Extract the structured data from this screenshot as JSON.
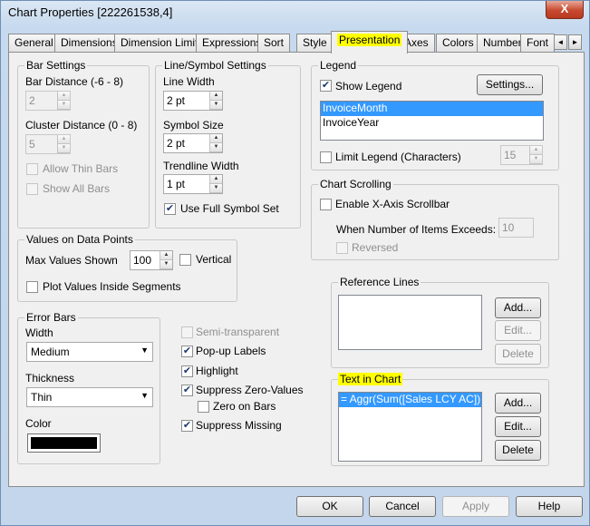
{
  "window": {
    "title": "Chart Properties [222261538,4]",
    "close_label": "X"
  },
  "tabs": [
    "General",
    "Dimensions",
    "Dimension Limits",
    "Expressions",
    "Sort",
    "Style",
    "Presentation",
    "Axes",
    "Colors",
    "Number",
    "Font"
  ],
  "active_tab": "Presentation",
  "tab_scroll": {
    "left": "◄",
    "right": "►"
  },
  "bar_settings": {
    "title": "Bar Settings",
    "bar_distance_label": "Bar Distance (-6 - 8)",
    "bar_distance_value": "2",
    "cluster_distance_label": "Cluster Distance (0 - 8)",
    "cluster_distance_value": "5",
    "allow_thin_bars": "Allow Thin Bars",
    "show_all_bars": "Show All Bars"
  },
  "line_symbol": {
    "title": "Line/Symbol Settings",
    "line_width_label": "Line Width",
    "line_width_value": "2 pt",
    "symbol_size_label": "Symbol Size",
    "symbol_size_value": "2 pt",
    "trendline_width_label": "Trendline Width",
    "trendline_width_value": "1 pt",
    "use_full_symbol_set": "Use Full Symbol Set"
  },
  "values_on_points": {
    "title": "Values on Data Points",
    "max_values_label": "Max Values Shown",
    "max_values_value": "100",
    "vertical": "Vertical",
    "plot_inside": "Plot Values Inside Segments"
  },
  "error_bars": {
    "title": "Error Bars",
    "width_label": "Width",
    "width_value": "Medium",
    "thickness_label": "Thickness",
    "thickness_value": "Thin",
    "color_label": "Color",
    "color_value": "#000000"
  },
  "options": {
    "semi_transparent": "Semi-transparent",
    "popup_labels": "Pop-up Labels",
    "highlight": "Highlight",
    "suppress_zero": "Suppress Zero-Values",
    "zero_on_bars": "Zero on Bars",
    "suppress_missing": "Suppress Missing"
  },
  "legend": {
    "title": "Legend",
    "show_legend": "Show Legend",
    "settings_button": "Settings...",
    "items": [
      "InvoiceMonth",
      "InvoiceYear"
    ],
    "limit_legend": "Limit Legend (Characters)",
    "limit_value": "15"
  },
  "chart_scrolling": {
    "title": "Chart Scrolling",
    "enable_scrollbar": "Enable X-Axis Scrollbar",
    "items_exceeds_label": "When Number of Items Exceeds:",
    "items_exceeds_value": "10",
    "reversed": "Reversed"
  },
  "reference_lines": {
    "title": "Reference Lines",
    "add": "Add...",
    "edit": "Edit...",
    "delete": "Delete"
  },
  "text_in_chart": {
    "title": "Text in Chart",
    "item": "= Aggr(Sum([Sales LCY AC]), Inv",
    "add": "Add...",
    "edit": "Edit...",
    "delete": "Delete"
  },
  "bottom_buttons": {
    "ok": "OK",
    "cancel": "Cancel",
    "apply": "Apply",
    "help": "Help"
  },
  "glyphs": {
    "check": "✔",
    "up": "▲",
    "down": "▼",
    "dropdown": "▼"
  }
}
